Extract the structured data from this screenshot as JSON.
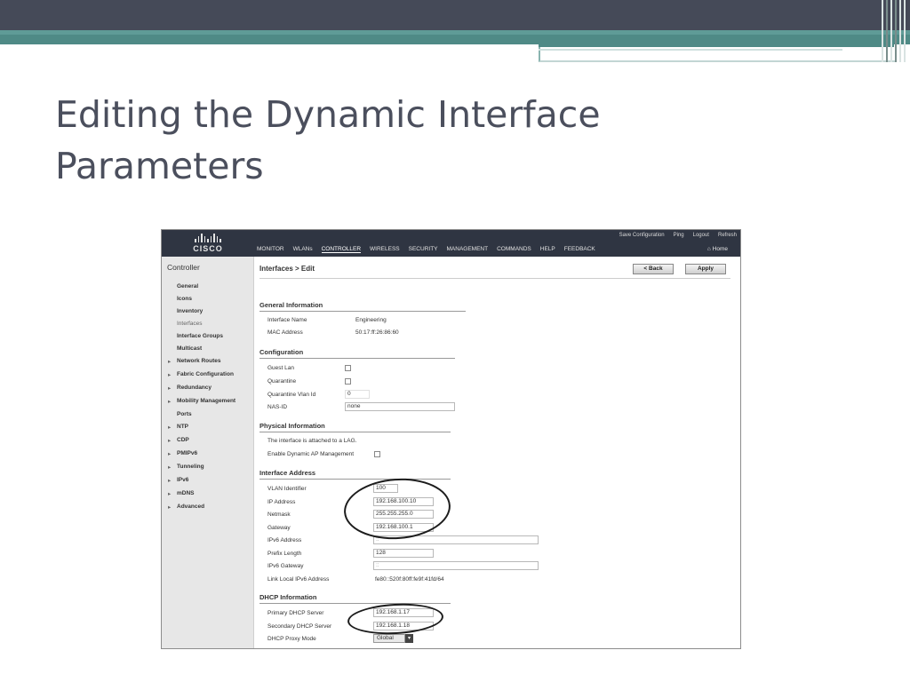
{
  "slide": {
    "title_line1": "Editing the Dynamic Interface",
    "title_line2": "Parameters"
  },
  "colors": {
    "slide_topbar": "#454a58",
    "slide_accent": "#4f8a86",
    "title_text": "#4b4f5d",
    "cisco_header": "#2f3542",
    "sidebar_bg": "#e7e7e7"
  },
  "screenshot": {
    "logo_text": "CISCO",
    "header_links": [
      "Save Configuration",
      "Ping",
      "Logout",
      "Refresh"
    ],
    "home_label": "Home",
    "nav": [
      "MONITOR",
      "WLANs",
      "CONTROLLER",
      "WIRELESS",
      "SECURITY",
      "MANAGEMENT",
      "COMMANDS",
      "HELP",
      "FEEDBACK"
    ],
    "sidebar": {
      "title": "Controller",
      "items": [
        "General",
        "Icons",
        "Inventory",
        "Interfaces",
        "Interface Groups",
        "Multicast",
        "Network Routes",
        "Fabric Configuration",
        "Redundancy",
        "Mobility Management",
        "Ports",
        "NTP",
        "CDP",
        "PMIPv6",
        "Tunneling",
        "IPv6",
        "mDNS",
        "Advanced"
      ]
    },
    "breadcrumb": "Interfaces > Edit",
    "buttons": {
      "back": "< Back",
      "apply": "Apply"
    },
    "general": {
      "heading": "General Information",
      "interface_name_label": "Interface Name",
      "interface_name_value": "Engineering",
      "mac_label": "MAC Address",
      "mac_value": "50:17:ff:26:86:60"
    },
    "configuration": {
      "heading": "Configuration",
      "guest_lan_label": "Guest Lan",
      "quarantine_label": "Quarantine",
      "quarantine_vlan_label": "Quarantine Vlan Id",
      "quarantine_vlan_value": "0",
      "nas_id_label": "NAS-ID",
      "nas_id_value": "none"
    },
    "physical": {
      "heading": "Physical Information",
      "lag_text": "The interface is attached to a LAG.",
      "dynamic_ap_label": "Enable Dynamic AP Management"
    },
    "interface_address": {
      "heading": "Interface Address",
      "vlan_label": "VLAN Identifier",
      "vlan_value": "100",
      "ip_label": "IP Address",
      "ip_value": "192.168.100.10",
      "netmask_label": "Netmask",
      "netmask_value": "255.255.255.0",
      "gateway_label": "Gateway",
      "gateway_value": "192.168.100.1",
      "ipv6_label": "IPv6 Address",
      "ipv6_value": "::",
      "prefix_label": "Prefix Length",
      "prefix_value": "128",
      "ipv6_gw_label": "IPv6 Gateway",
      "ipv6_gw_value": "::",
      "link_local_label": "Link Local IPv6 Address",
      "link_local_value": "fe80::520f:80ff:fe9f:41fd/64"
    },
    "dhcp": {
      "heading": "DHCP Information",
      "primary_label": "Primary DHCP Server",
      "primary_value": "192.168.1.17",
      "secondary_label": "Secondary DHCP Server",
      "secondary_value": "192.168.1.18",
      "proxy_label": "DHCP Proxy Mode",
      "proxy_value": "Global"
    }
  }
}
